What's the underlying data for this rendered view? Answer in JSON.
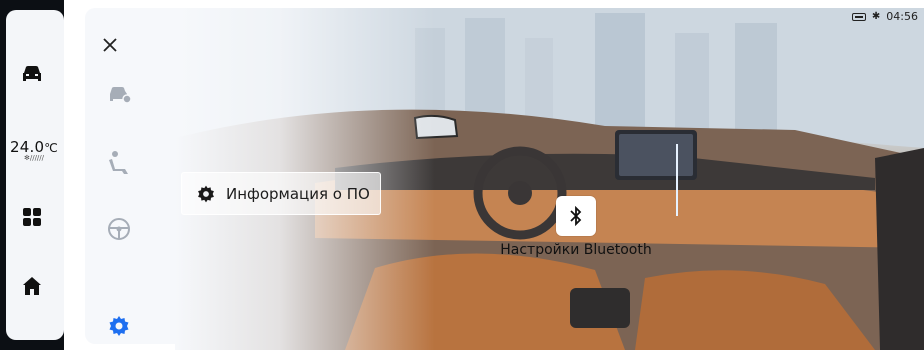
{
  "status_bar": {
    "time": "04:56"
  },
  "climate": {
    "temperature": "24.0",
    "unit": "℃",
    "fan_level": "//////"
  },
  "menu": {
    "close_label": "×"
  },
  "labels": {
    "software_info": "Информация о ПО",
    "bluetooth_settings": "Настройки Bluetooth"
  },
  "colors": {
    "accent": "#1e6ff0",
    "icon_gray": "#a6adb7",
    "dock_bg": "#0c0f14"
  },
  "icons": [
    "car-icon",
    "apps-grid-icon",
    "home-icon",
    "close-icon",
    "car-settings-icon",
    "seat-icon",
    "steering-wheel-icon",
    "gear-icon",
    "bluetooth-icon",
    "battery-icon"
  ]
}
